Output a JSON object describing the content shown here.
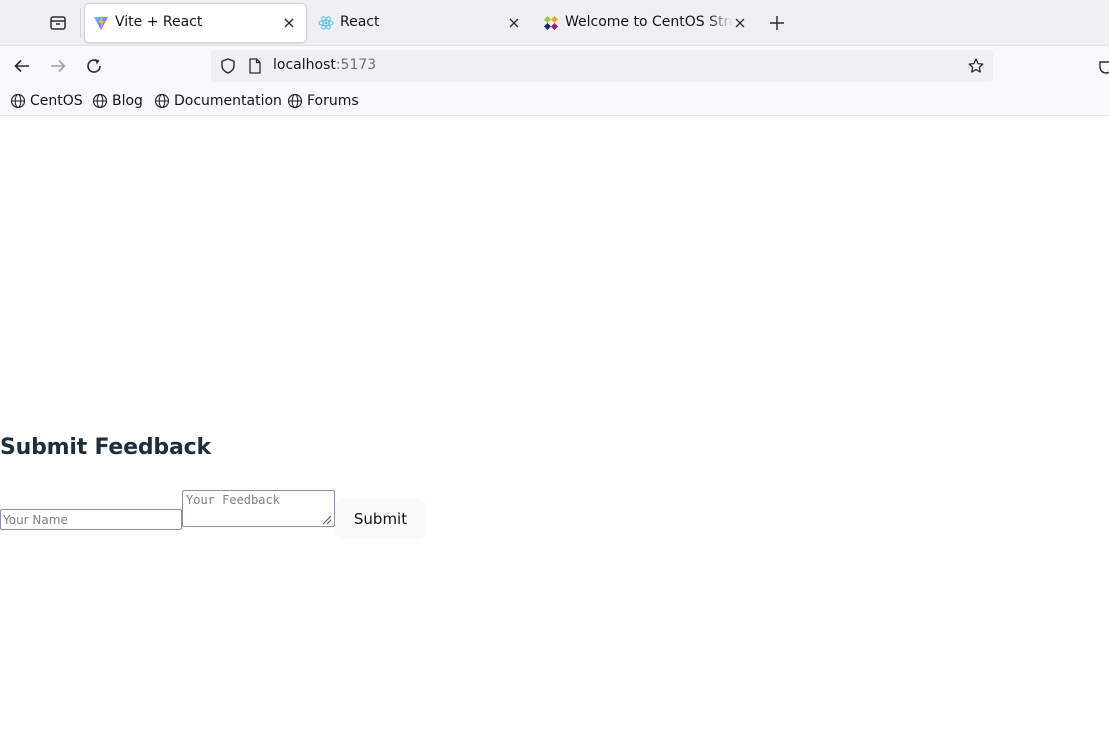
{
  "browser": {
    "tabs": [
      {
        "title": "Vite + React",
        "active": true,
        "favicon": "vite-icon"
      },
      {
        "title": "React",
        "active": false,
        "favicon": "react-icon"
      },
      {
        "title": "Welcome to CentOS Strea",
        "active": false,
        "favicon": "centos-icon"
      }
    ],
    "url": {
      "host": "localhost",
      "port": ":5173"
    },
    "bookmarks": [
      {
        "label": "CentOS",
        "icon": "globe-icon"
      },
      {
        "label": "Blog",
        "icon": "globe-icon"
      },
      {
        "label": "Documentation",
        "icon": "globe-icon"
      },
      {
        "label": "Forums",
        "icon": "globe-icon"
      }
    ]
  },
  "page": {
    "heading": "Submit Feedback",
    "name_input": {
      "placeholder": "Your Name",
      "value": ""
    },
    "feedback_input": {
      "placeholder": "Your Feedback",
      "value": ""
    },
    "submit_label": "Submit"
  },
  "colors": {
    "heading": "#1f2e3d",
    "tabstrip_bg": "#f0f0f4",
    "toolbar_bg": "#f9f9fb",
    "button_bg": "#f9f9f9"
  }
}
